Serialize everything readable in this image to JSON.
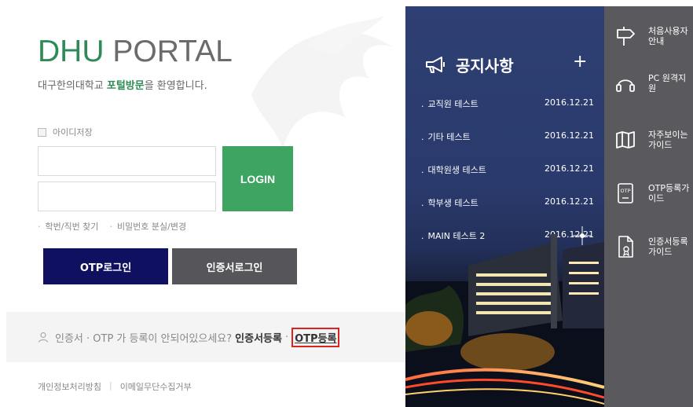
{
  "brand": {
    "part1": "DHU",
    "part2": "PORTAL"
  },
  "welcome": {
    "prefix": "대구한의대학교 ",
    "highlight": "포털방문",
    "suffix": "을 환영합니다."
  },
  "login": {
    "save_id_label": "아이디저장",
    "id_value": "",
    "pw_value": "",
    "login_label": "LOGIN",
    "find_id_label": "학번/직번 찾기",
    "find_pw_label": "비밀번호 분실/변경"
  },
  "auth_buttons": {
    "otp_label": "OTP로그인",
    "cert_label": "인증서로그인"
  },
  "register_notice": {
    "question": "인증서 · OTP 가 등록이 안되어있으세요?",
    "cert_link": "인증서등록",
    "sep": "·",
    "otp_link": "OTP등록"
  },
  "footer": {
    "privacy": "개인정보처리방침",
    "divider": "|",
    "email_policy": "이메일무단수집거부"
  },
  "news": {
    "title": "공지사항",
    "plus": "+",
    "items": [
      {
        "title": "교직원 테스트",
        "date": "2016.12.21"
      },
      {
        "title": "기타 테스트",
        "date": "2016.12.21"
      },
      {
        "title": "대학원생 테스트",
        "date": "2016.12.21"
      },
      {
        "title": "학부생 테스트",
        "date": "2016.12.21"
      },
      {
        "title": "MAIN 테스트 2",
        "date": "2016.12.21"
      }
    ]
  },
  "sidebar": {
    "items": [
      {
        "label": "처음사용자 안내",
        "icon": "signpost-icon"
      },
      {
        "label": "PC 원격지원",
        "icon": "headset-icon"
      },
      {
        "label": "자주보이는 가이드",
        "icon": "map-icon"
      },
      {
        "label": "OTP등록가 이드",
        "icon": "otp-icon",
        "icon_text": "OTP"
      },
      {
        "label": "인증서등록 가이드",
        "icon": "certificate-icon"
      }
    ]
  },
  "colors": {
    "brand_green": "#2e8b57",
    "login_green": "#3ea461",
    "otp_navy": "#101060",
    "cert_gray": "#55555a",
    "sidebar_gray": "#5a5a5e",
    "highlight_red": "#dd2222"
  }
}
